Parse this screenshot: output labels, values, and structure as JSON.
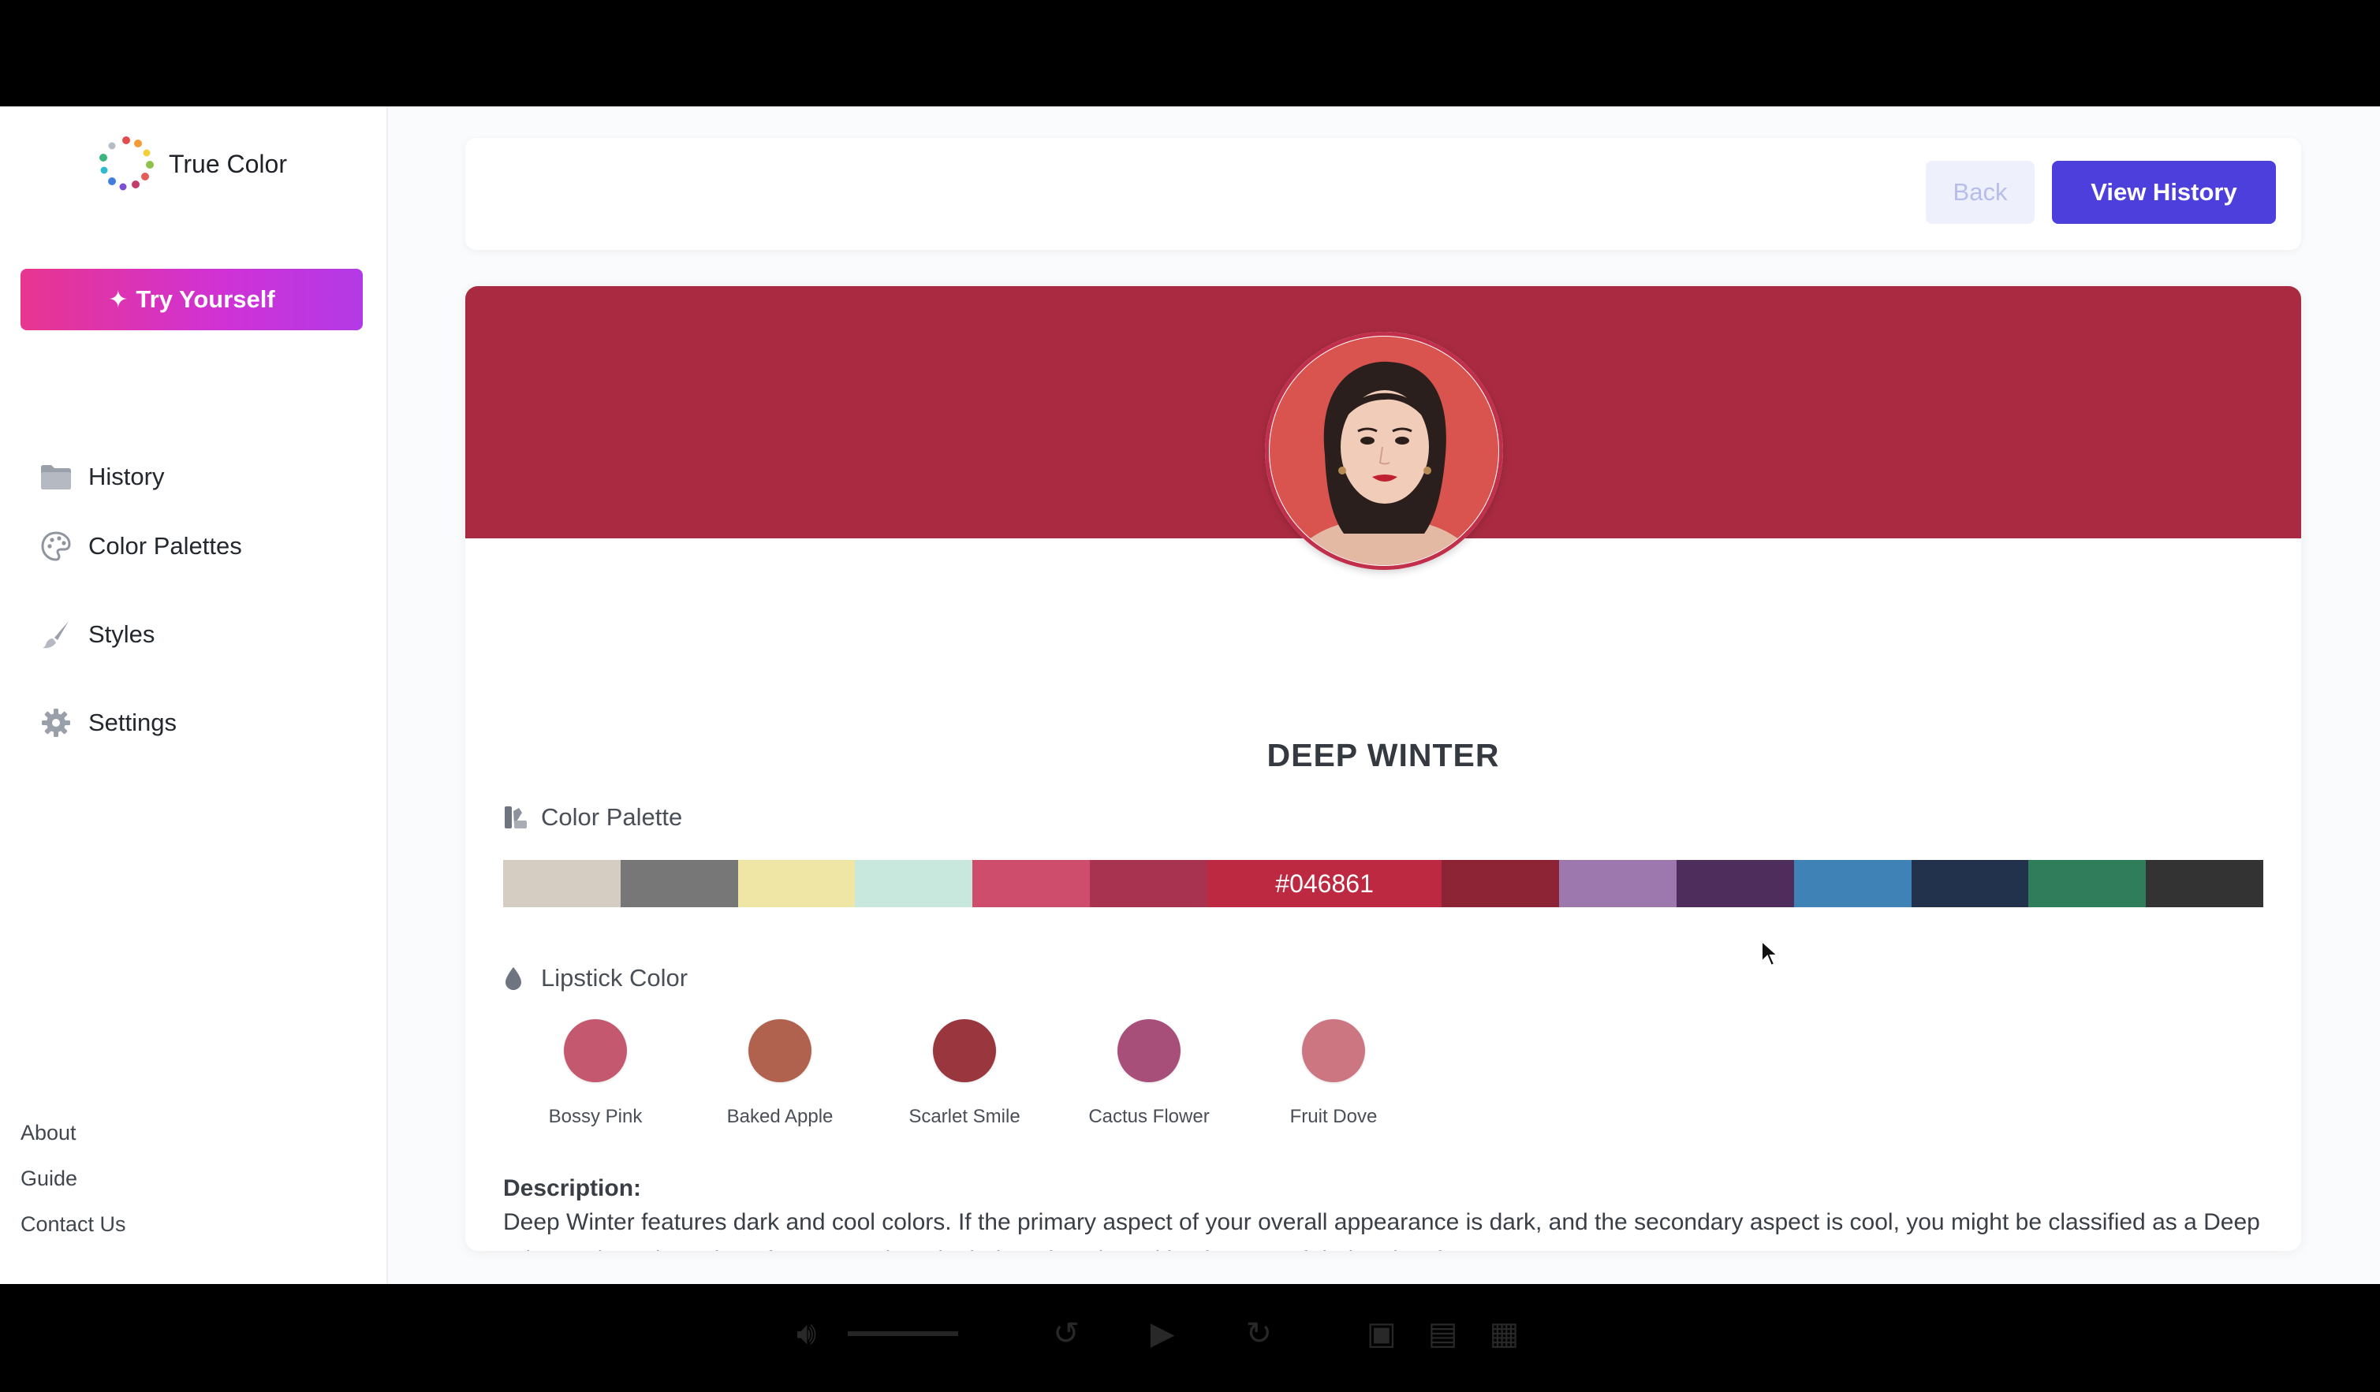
{
  "app": {
    "name": "True Color"
  },
  "sidebar": {
    "cta_label": "Try Yourself",
    "items": [
      {
        "label": "History",
        "icon": "folder-icon"
      },
      {
        "label": "Color Palettes",
        "icon": "palette-icon"
      },
      {
        "label": "Styles",
        "icon": "brush-icon"
      },
      {
        "label": "Settings",
        "icon": "gear-icon"
      }
    ],
    "footer_links": [
      "About",
      "Guide",
      "Contact Us"
    ]
  },
  "topbar": {
    "back_label": "Back",
    "history_label": "View History"
  },
  "result": {
    "season": "DEEP WINTER",
    "palette_label": "Color Palette",
    "palette": [
      {
        "color": "#d5cdc2"
      },
      {
        "color": "#777777"
      },
      {
        "color": "#efe6a6"
      },
      {
        "color": "#c8e8dd"
      },
      {
        "color": "#cf4d6c"
      },
      {
        "color": "#a83350"
      },
      {
        "color": "#be2942",
        "label": "#046861"
      },
      {
        "color": "#8d2435"
      },
      {
        "color": "#9c78af"
      },
      {
        "color": "#4e2d5d"
      },
      {
        "color": "#3f82b6"
      },
      {
        "color": "#22324d"
      },
      {
        "color": "#2f7d5a"
      },
      {
        "color": "#333333"
      }
    ],
    "lipstick_label": "Lipstick Color",
    "lipsticks": [
      {
        "name": "Bossy Pink",
        "color": "#c4586f"
      },
      {
        "name": "Baked Apple",
        "color": "#b1624e"
      },
      {
        "name": "Scarlet Smile",
        "color": "#9a363d"
      },
      {
        "name": "Cactus Flower",
        "color": "#a74f79"
      },
      {
        "name": "Fruit Dove",
        "color": "#cc7682"
      }
    ],
    "description_title": "Description:",
    "description": "Deep Winter features dark and cool colors. If the primary aspect of your overall appearance is dark, and the secondary aspect is cool, you might be classified as a Deep Winter. The color palette for Deep Winter is dark and cool, evoking images of dark, misty forests."
  },
  "colors": {
    "banner": "#aa2b41",
    "primary": "#4d3fdc",
    "cta_gradient": [
      "#e8358f",
      "#b23ae6"
    ]
  }
}
